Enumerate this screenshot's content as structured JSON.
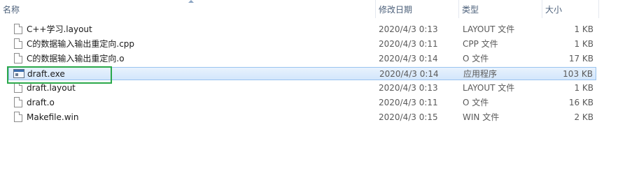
{
  "columns": {
    "name": "名称",
    "date": "修改日期",
    "type": "类型",
    "size": "大小"
  },
  "files": [
    {
      "name": "C++学习.layout",
      "date": "2020/4/3 0:13",
      "type": "LAYOUT 文件",
      "size": "1 KB",
      "icon": "file-icon"
    },
    {
      "name": "C的数据输入输出重定向.cpp",
      "date": "2020/4/3 0:11",
      "type": "CPP 文件",
      "size": "1 KB",
      "icon": "file-icon"
    },
    {
      "name": "C的数据输入输出重定向.o",
      "date": "2020/4/3 0:14",
      "type": "O 文件",
      "size": "17 KB",
      "icon": "file-icon"
    },
    {
      "name": "draft.exe",
      "date": "2020/4/3 0:14",
      "type": "应用程序",
      "size": "103 KB",
      "icon": "application-icon"
    },
    {
      "name": "draft.layout",
      "date": "2020/4/3 0:13",
      "type": "LAYOUT 文件",
      "size": "1 KB",
      "icon": "file-icon"
    },
    {
      "name": "draft.o",
      "date": "2020/4/3 0:11",
      "type": "O 文件",
      "size": "16 KB",
      "icon": "file-icon"
    },
    {
      "name": "Makefile.win",
      "date": "2020/4/3 0:15",
      "type": "WIN 文件",
      "size": "2 KB",
      "icon": "file-icon"
    }
  ],
  "selected_index": 3,
  "colors": {
    "selection_fill": "#d3e6fb",
    "selection_border": "#99c3ef",
    "highlight_box": "#2aa84a",
    "header_text": "#4c607a"
  }
}
